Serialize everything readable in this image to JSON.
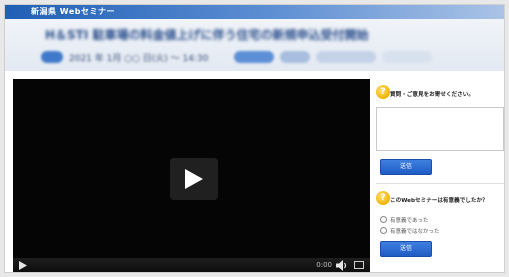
{
  "banner": {
    "top_label": "新潟県 Webセミナー",
    "heading": "H＆STI 駐車場の料金値上げに伴う住宅の新規申込受付開始",
    "subtext": "2021 年 1月 ○○ 日(火) ～ 14:30",
    "colors": {
      "brand": "#1f5fb5",
      "heading": "#2b4f8c"
    }
  },
  "player": {
    "time": "0:00",
    "icons": [
      "play-icon",
      "volume-icon",
      "fullscreen-icon"
    ]
  },
  "sidebar": {
    "question_form": {
      "icon_char": "?",
      "prompt": "質問・ご意見をお寄せください。",
      "send_label": "送信"
    },
    "survey": {
      "icon_char": "?",
      "prompt": "このWebセミナーは有意義でしたか？",
      "options": [
        "有意義であった",
        "有意義ではなかった"
      ],
      "send_label": "送信"
    },
    "colors": {
      "button": "#2a6fd6",
      "icon": "#f1b400"
    }
  }
}
